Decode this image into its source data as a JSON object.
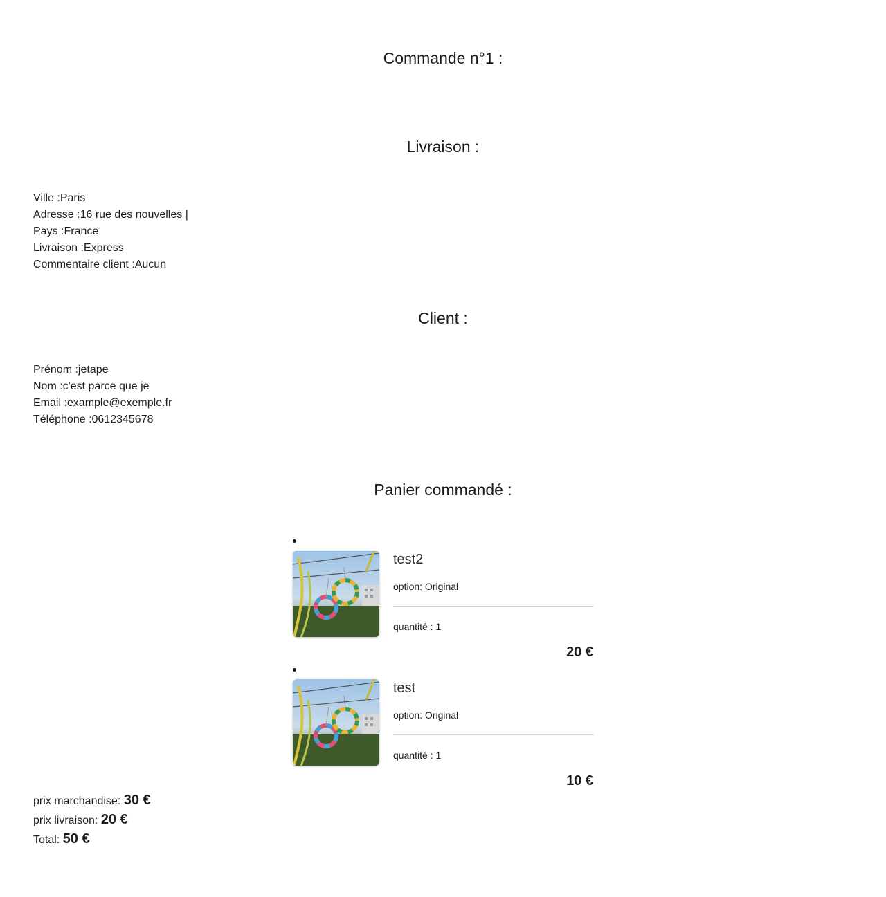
{
  "order": {
    "title": "Commande n°1 :"
  },
  "delivery": {
    "heading": "Livraison :",
    "ville": "Ville :Paris",
    "adresse": "Adresse :16 rue des nouvelles |",
    "pays": "Pays :France",
    "livraison": "Livraison :Express",
    "commentaire": "Commentaire client :Aucun"
  },
  "client": {
    "heading": "Client :",
    "prenom": "Prénom :jetape",
    "nom": "Nom :c'est parce que je",
    "email": "Email :example@exemple.fr",
    "telephone": "Téléphone :0612345678"
  },
  "cart": {
    "heading": "Panier commandé :",
    "items": [
      {
        "name": "test2",
        "option": "option: Original",
        "quantity": "quantité : 1",
        "price": "20  €"
      },
      {
        "name": "test",
        "option": "option: Original",
        "quantity": "quantité : 1",
        "price": "10  €"
      }
    ]
  },
  "totals": {
    "merch_label": "prix marchandise: ",
    "merch_value": "30  €",
    "shipping_label": "prix livraison: ",
    "shipping_value": "20  €",
    "total_label": "Total: ",
    "total_value": "50  €"
  }
}
